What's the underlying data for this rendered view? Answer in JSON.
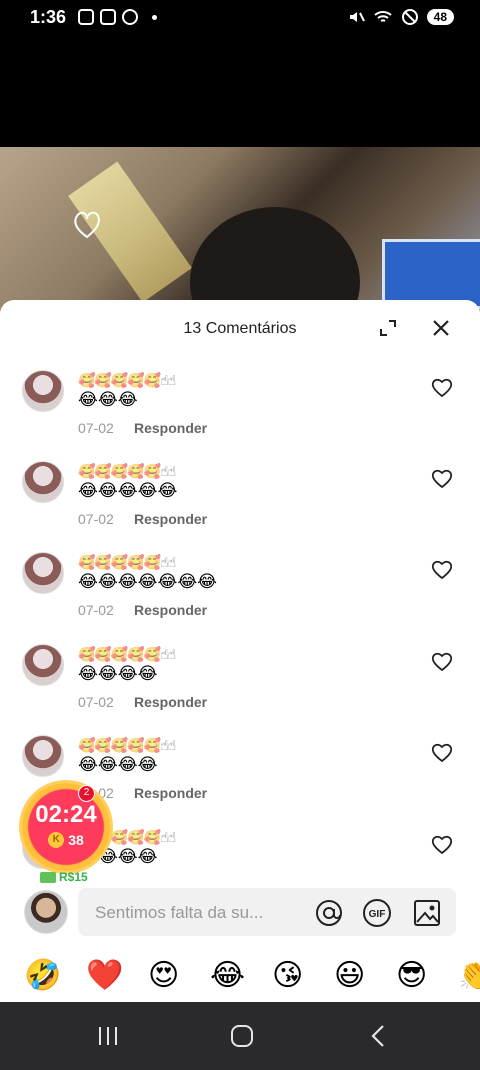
{
  "status_bar": {
    "time": "1:36",
    "battery": "48"
  },
  "sheet": {
    "title": "13 Comentários"
  },
  "comments": [
    {
      "line1": "🥰🥰🥰🥰🥰☝☝",
      "line2": "😂😂😂",
      "date": "07-02",
      "reply": "Responder"
    },
    {
      "line1": "🥰🥰🥰🥰🥰☝☝",
      "line2": "😂😂😂😂😂",
      "date": "07-02",
      "reply": "Responder"
    },
    {
      "line1": "🥰🥰🥰🥰🥰☝☝",
      "line2": "😂😂😂😂😂😂😂",
      "date": "07-02",
      "reply": "Responder"
    },
    {
      "line1": "🥰🥰🥰🥰🥰☝☝",
      "line2": "😂😂😂😂",
      "date": "07-02",
      "reply": "Responder"
    },
    {
      "line1": "🥰🥰🥰🥰🥰☝☝",
      "line2": "😂😂😂😂",
      "date": "07-02",
      "reply": "Responder"
    },
    {
      "line1": "🥰🥰🥰🥰🥰☝☝",
      "line2": "😂😂😂😂",
      "date": "",
      "reply": ""
    }
  ],
  "timer": {
    "time": "02:24",
    "coins": "38",
    "badge": "2"
  },
  "reward": {
    "label": "R$15"
  },
  "input": {
    "placeholder": "Sentimos falta da su..."
  },
  "emoji_bar": [
    "🤣",
    "❤️",
    "😍",
    "😂",
    "😘",
    "😃",
    "😎",
    "👏"
  ],
  "colors": {
    "timer": "#ff3b5c",
    "reward": "#34b24a",
    "navbar": "#2a2a2c"
  }
}
